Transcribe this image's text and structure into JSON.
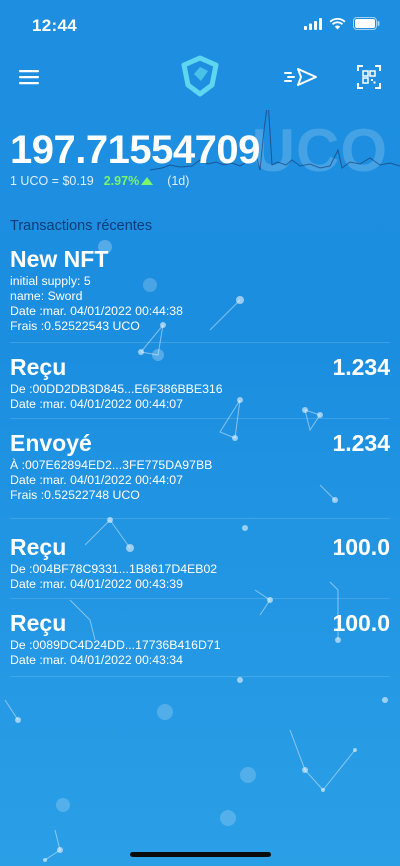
{
  "status_bar": {
    "time": "12:44",
    "icons": [
      "signal-icon",
      "wifi-icon",
      "battery-icon"
    ]
  },
  "nav": {
    "menu_icon": "hamburger-menu-icon",
    "logo_icon": "archethic-logo-icon",
    "send_icon": "send-icon",
    "qr_icon": "qr-code-icon"
  },
  "balance": {
    "amount": "197.71554709",
    "ticker": "UCO",
    "price": "1 UCO = $0.19",
    "change": "2.97%",
    "change_direction": "up",
    "period": "(1d)"
  },
  "transactions": {
    "title": "Transactions récentes",
    "items": [
      {
        "type": "New NFT",
        "amount": "",
        "lines": [
          "initial supply: 5",
          "name: Sword",
          "Date :mar. 04/01/2022 00:44:38",
          "Frais :0.52522543 UCO"
        ]
      },
      {
        "type": "Reçu",
        "amount": "1.234",
        "lines": [
          "De :00DD2DB3D845...E6F386BBE316",
          "Date :mar. 04/01/2022 00:44:07"
        ]
      },
      {
        "type": "Envoyé",
        "amount": "1.234",
        "lines": [
          "À :007E62894ED2...3FE775DA97BB",
          "Date :mar. 04/01/2022 00:44:07",
          "Frais :0.52522748 UCO"
        ]
      },
      {
        "type": "Reçu",
        "amount": "100.0",
        "lines": [
          "De :004BF78C9331...1B8617D4EB02",
          "Date :mar. 04/01/2022 00:43:39"
        ]
      },
      {
        "type": "Reçu",
        "amount": "100.0",
        "lines": [
          "De :0089DC4D24DD...17736B416D71",
          "Date :mar. 04/01/2022 00:43:34"
        ]
      }
    ]
  },
  "colors": {
    "background": "#1e8fe0",
    "section_title": "#0d3c78",
    "positive_change": "#7bf56a"
  }
}
